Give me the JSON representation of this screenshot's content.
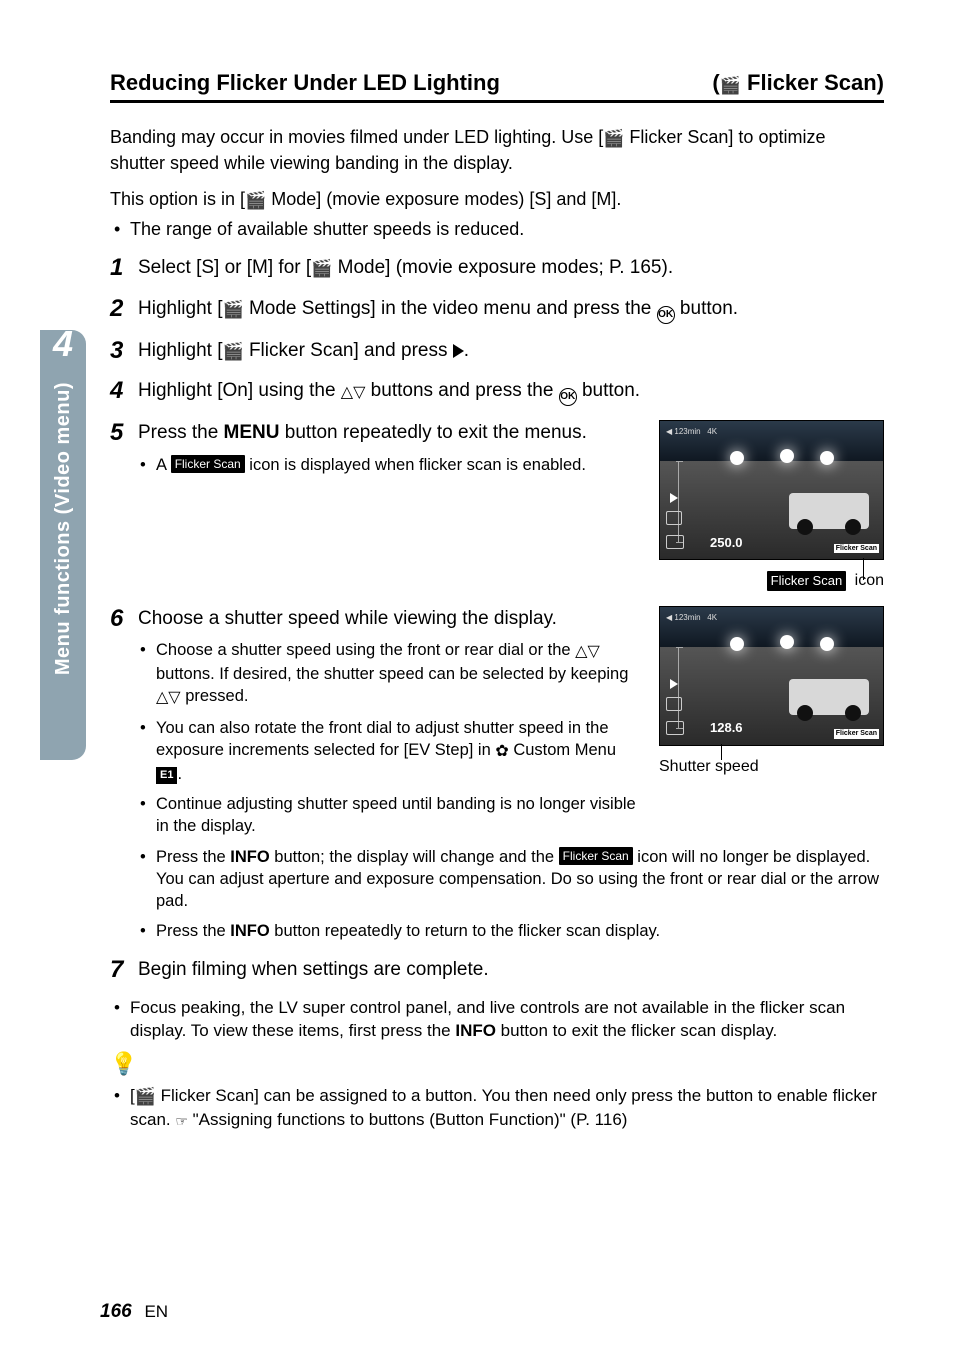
{
  "sideTab": {
    "number": "4",
    "label": "Menu functions (Video menu)"
  },
  "heading": {
    "left": "Reducing Flicker Under LED Lighting",
    "rightPrefix": "(",
    "rightIcon": "n",
    "rightText": " Flicker Scan)"
  },
  "intro": {
    "p1a": "Banding may occur in movies filmed under LED lighting. Use [",
    "p1b": " Flicker Scan] to optimize shutter speed while viewing banding in the display.",
    "p2a": "This option is in [",
    "p2b": " Mode] (movie exposure modes) [S] and [M].",
    "b1": "The range of available shutter speeds is reduced."
  },
  "steps": {
    "s1": {
      "n": "1",
      "a": "Select [S] or [M] for [",
      "b": " Mode] (movie exposure modes; P. 165)."
    },
    "s2": {
      "n": "2",
      "a": "Highlight [",
      "b": " Mode Settings] in the video menu and press the ",
      "c": " button."
    },
    "s3": {
      "n": "3",
      "a": "Highlight [",
      "b": " Flicker Scan] and press ",
      "c": "."
    },
    "s4": {
      "n": "4",
      "a": "Highlight [On] using the ",
      "b": " buttons and press the ",
      "c": " button."
    },
    "s5": {
      "n": "5",
      "main": "Press the MENU button repeatedly to exit the menus.",
      "sub1a": "A ",
      "sub1b": " icon is displayed when flicker scan is enabled."
    },
    "s6": {
      "n": "6",
      "main": "Choose a shutter speed while viewing the display.",
      "sub1a": "Choose a shutter speed using the front or rear dial or the ",
      "sub1b": " buttons. If desired, the shutter speed can be selected by keeping ",
      "sub1c": " pressed.",
      "sub2a": "You can also rotate the front dial to adjust shutter speed in the exposure increments selected for [EV Step] in ",
      "sub2b": " Custom Menu ",
      "sub2c": ".",
      "sub3": "Continue adjusting shutter speed until banding is no longer visible in the display.",
      "sub4a": "Press the ",
      "sub4b": " button; the display will change and the ",
      "sub4c": " icon will no longer be displayed. You can adjust aperture and exposure compensation. Do so using the front or rear dial or the arrow pad.",
      "sub5a": "Press the ",
      "sub5b": " button repeatedly to return to the flicker scan display."
    },
    "s7": {
      "n": "7",
      "main": "Begin filming when settings are complete."
    }
  },
  "note": {
    "b1a": "Focus peaking, the LV super control panel, and live controls are not available in the flicker scan display. To view these items, first press the ",
    "b1b": " button to exit the flicker scan display."
  },
  "tip": {
    "b1a": "[",
    "b1b": " Flicker Scan] can be assigned to a button. You then need only press the button to enable flicker scan. ",
    "b1c": " \"Assigning functions to buttons (Button Function)\" (P. 116)"
  },
  "labels": {
    "menu": "MENU",
    "info": "INFO",
    "ok": "OK",
    "flickerScan": "Flicker Scan",
    "e1": "E1"
  },
  "thumbs": {
    "t1": {
      "value": "250.0",
      "fs": "Flicker Scan",
      "caption": " icon",
      "captionLabel": "Flicker Scan"
    },
    "t2": {
      "value": "128.6",
      "fs": "Flicker Scan",
      "caption": "Shutter speed"
    }
  },
  "footer": {
    "page": "166",
    "lang": "EN"
  }
}
